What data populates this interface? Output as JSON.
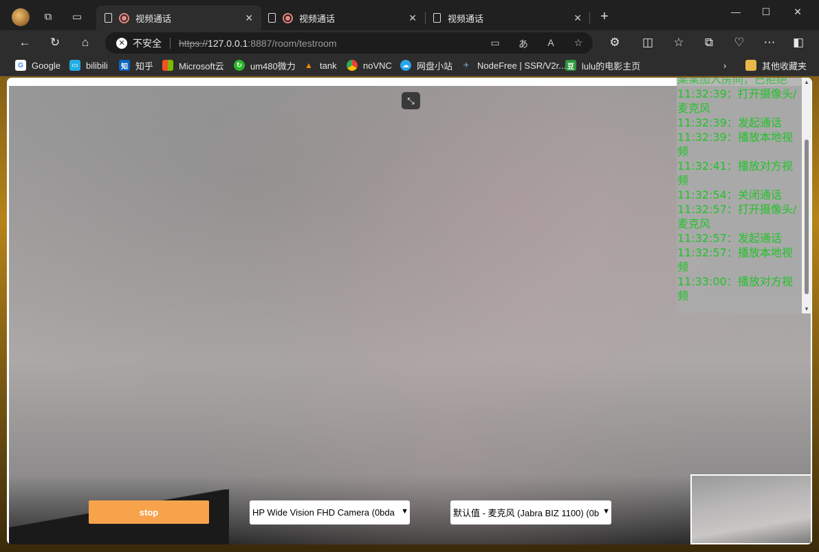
{
  "browser": {
    "tabs": [
      {
        "title": "视频通话",
        "recording": true,
        "active": true
      },
      {
        "title": "视频通话",
        "recording": true,
        "active": false
      },
      {
        "title": "视频通话",
        "recording": false,
        "active": false
      }
    ],
    "address": {
      "security_label": "不安全",
      "scheme": "https://",
      "host": "127.0.0.1",
      "rest": ":8887/room/testroom"
    },
    "bookmarks": [
      {
        "label": "Google",
        "icon": "google-icon",
        "color": "#4285f4"
      },
      {
        "label": "bilibili",
        "icon": "bilibili-icon",
        "color": "#23ade5"
      },
      {
        "label": "知乎",
        "icon": "zhihu-icon",
        "color": "#0a66c2"
      },
      {
        "label": "Microsoft云",
        "icon": "microsoft-icon",
        "color": "#f25022"
      },
      {
        "label": "um480微力",
        "icon": "sync-icon",
        "color": "#2ab52a"
      },
      {
        "label": "tank",
        "icon": "triangle-icon",
        "color": "#f08a00"
      },
      {
        "label": "noVNC",
        "icon": "chrome-icon",
        "color": "#4caf50"
      },
      {
        "label": "网盘小站",
        "icon": "cloud-icon",
        "color": "#2aa4e8"
      },
      {
        "label": "NodeFree | SSR/V2r...",
        "icon": "plane-icon",
        "color": "#7fb0d0"
      },
      {
        "label": "lulu的电影主页",
        "icon": "douban-icon",
        "color": "#2e963d"
      }
    ],
    "other_bookmarks": "其他收藏夹"
  },
  "page": {
    "log_lines": [
      "11:32:39：打开摄像头/麦克风",
      "11:32:39：发起通话",
      "11:32:39：播放本地视频",
      "11:32:41：播放对方视频",
      "11:32:54：关闭通话",
      "11:32:57：打开摄像头/麦克风",
      "11:32:57：发起通话",
      "11:32:57：播放本地视频",
      "11:33:00：播放对方视频"
    ],
    "log_top_partial": "某某加入房间，已拒绝",
    "stop_label": "stop",
    "camera_select": "HP Wide Vision FHD Camera (0bda",
    "mic_select": "默认值 - 麦克风 (Jabra BIZ 1100) (0b"
  }
}
